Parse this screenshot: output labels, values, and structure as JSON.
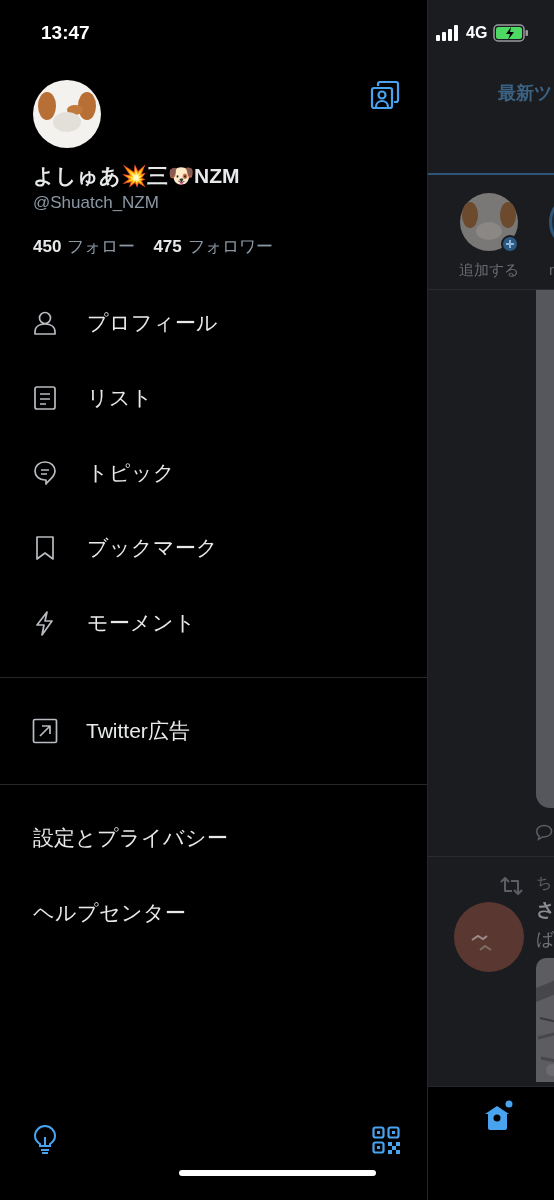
{
  "status_bar": {
    "time": "13:47",
    "network": "4G"
  },
  "drawer": {
    "account": {
      "display_name": "よしゅあ💥三🐶NZM",
      "handle": "@Shuatch_NZM",
      "following_count": "450",
      "following_label": "フォロー",
      "followers_count": "475",
      "followers_label": "フォロワー"
    },
    "menu": [
      {
        "label": "プロフィール"
      },
      {
        "label": "リスト"
      },
      {
        "label": "トピック"
      },
      {
        "label": "ブックマーク"
      },
      {
        "label": "モーメント"
      }
    ],
    "promo": {
      "label": "Twitter広告"
    },
    "links": [
      {
        "label": "設定とプライバシー"
      },
      {
        "label": "ヘルプセンター"
      }
    ]
  },
  "timeline": {
    "tab_label": "最新ツ",
    "fleets": [
      {
        "kind": "add",
        "label": "追加する"
      },
      {
        "kind": "user",
        "label": "r"
      }
    ],
    "tweet": {
      "retweeter": "ち",
      "author": "さ",
      "text": "ば"
    }
  }
}
